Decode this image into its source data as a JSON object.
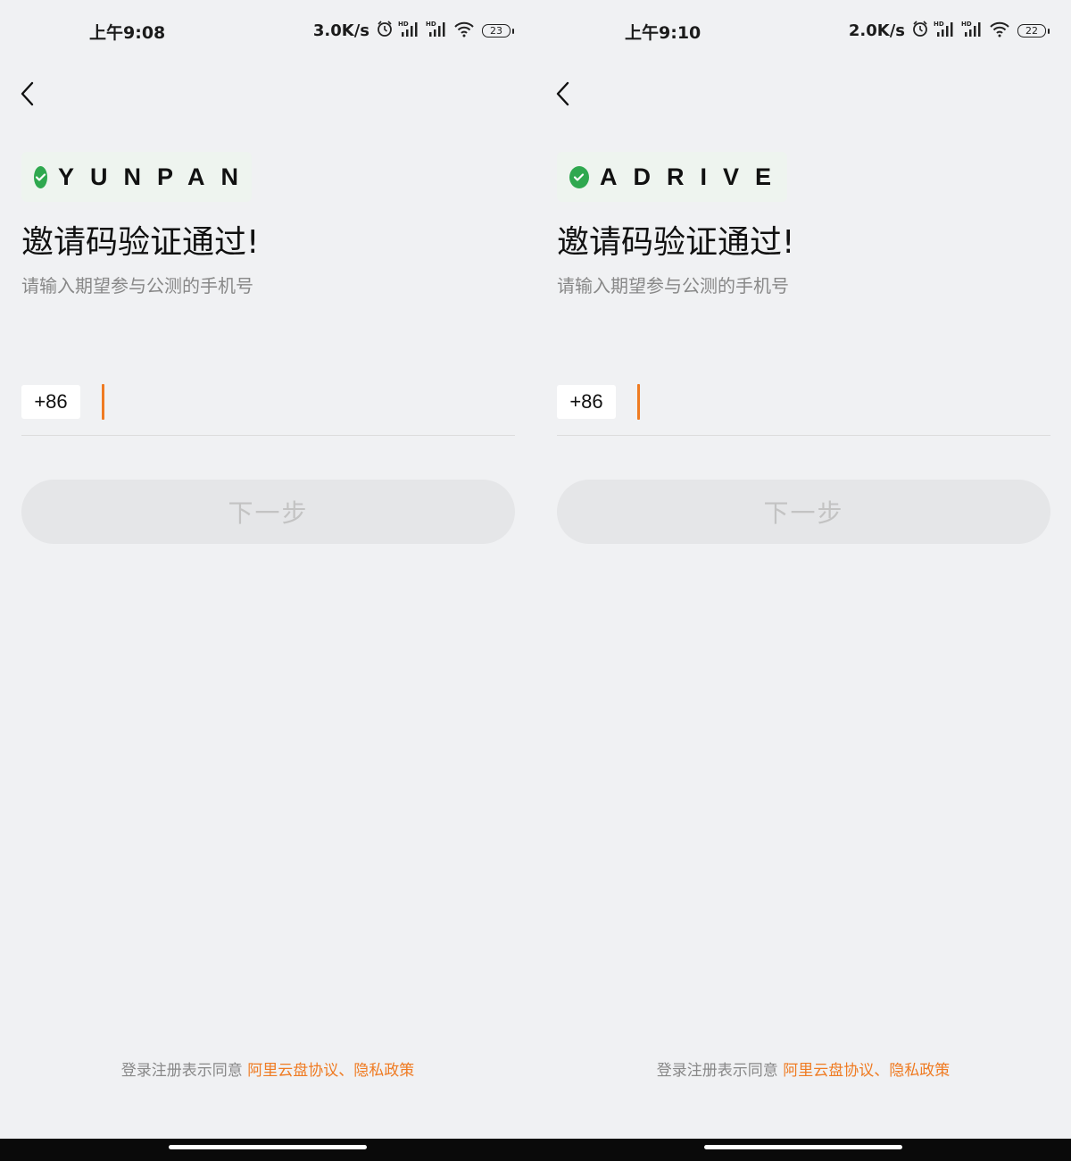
{
  "screens": [
    {
      "status": {
        "time": "上午9:08",
        "speed": "3.0K/s",
        "battery": "23"
      },
      "brand": "YUNPAN",
      "title": "邀请码验证通过!",
      "subtitle": "请输入期望参与公测的手机号",
      "country_code": "+86",
      "phone_value": "",
      "next_label": "下一步",
      "agreement_prefix": "登录注册表示同意",
      "agreement_link1": "阿里云盘协议",
      "agreement_sep": "、",
      "agreement_link2": "隐私政策"
    },
    {
      "status": {
        "time": "上午9:10",
        "speed": "2.0K/s",
        "battery": "22"
      },
      "brand": "ADRIVE",
      "title": "邀请码验证通过!",
      "subtitle": "请输入期望参与公测的手机号",
      "country_code": "+86",
      "phone_value": "",
      "next_label": "下一步",
      "agreement_prefix": "登录注册表示同意",
      "agreement_link1": "阿里云盘协议",
      "agreement_sep": "、",
      "agreement_link2": "隐私政策"
    }
  ],
  "icons": {
    "alarm": "alarm-icon",
    "signal_hd_1": "signal-hd-icon",
    "signal_hd_2": "signal-hd-icon",
    "wifi": "wifi-icon",
    "battery": "battery-icon",
    "back": "back-arrow-icon",
    "check": "check-circle-icon"
  },
  "colors": {
    "accent": "#ef7b22",
    "check_green": "#2fa84f",
    "background": "#f0f1f3",
    "button_disabled_bg": "#e5e6e8",
    "button_disabled_text": "#c3c3c3"
  }
}
